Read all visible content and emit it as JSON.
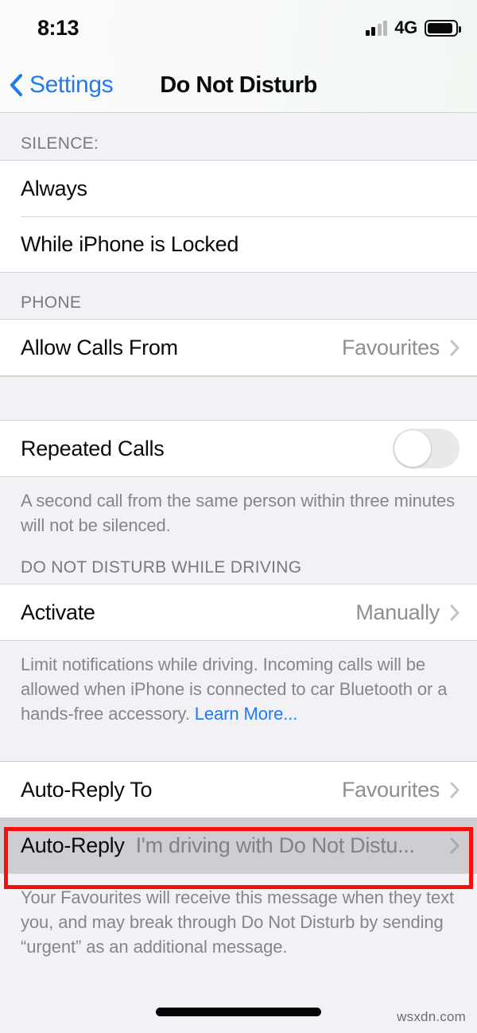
{
  "status_bar": {
    "time": "8:13",
    "network": "4G",
    "signal_bars_filled": 2,
    "signal_bars_total": 4,
    "battery_icon": "battery-full-icon"
  },
  "nav": {
    "back_label": "Settings",
    "back_icon": "chevron-left-icon",
    "title": "Do Not Disturb"
  },
  "sections": {
    "silence": {
      "header": "SILENCE:",
      "rows": [
        {
          "title": "Always"
        },
        {
          "title": "While iPhone is Locked"
        }
      ]
    },
    "phone": {
      "header": "PHONE",
      "rows": [
        {
          "title": "Allow Calls From",
          "value": "Favourites",
          "accessory": "chevron-right-icon"
        }
      ]
    },
    "repeated_calls": {
      "row": {
        "title": "Repeated Calls",
        "toggle_state": "off"
      },
      "footnote": "A second call from the same person within three minutes will not be silenced."
    },
    "driving": {
      "header": "DO NOT DISTURB WHILE DRIVING",
      "rows": [
        {
          "title": "Activate",
          "value": "Manually",
          "accessory": "chevron-right-icon"
        }
      ],
      "footnote_text": "Limit notifications while driving. Incoming calls will be allowed when iPhone is connected to car Bluetooth or a hands-free accessory. ",
      "footnote_link": "Learn More..."
    },
    "auto_reply": {
      "rows": [
        {
          "title": "Auto-Reply To",
          "value": "Favourites",
          "accessory": "chevron-right-icon"
        },
        {
          "title": "Auto-Reply",
          "value": "I'm driving with Do Not Distu...",
          "accessory": "chevron-right-icon",
          "selected": true
        }
      ],
      "footnote": "Your Favourites will receive this message when they text you, and may break through Do Not Disturb by sending “urgent” as an additional message."
    }
  },
  "annotation": {
    "highlight_color": "#fc0d09",
    "target": "Auto-Reply"
  },
  "watermark": "wsxdn.com",
  "colors": {
    "accent_blue": "#207bf2",
    "group_background": "#f2f1f6",
    "row_background": "#ffffff",
    "selected_row": "#cecdd2",
    "secondary_text": "#8e8e93"
  }
}
